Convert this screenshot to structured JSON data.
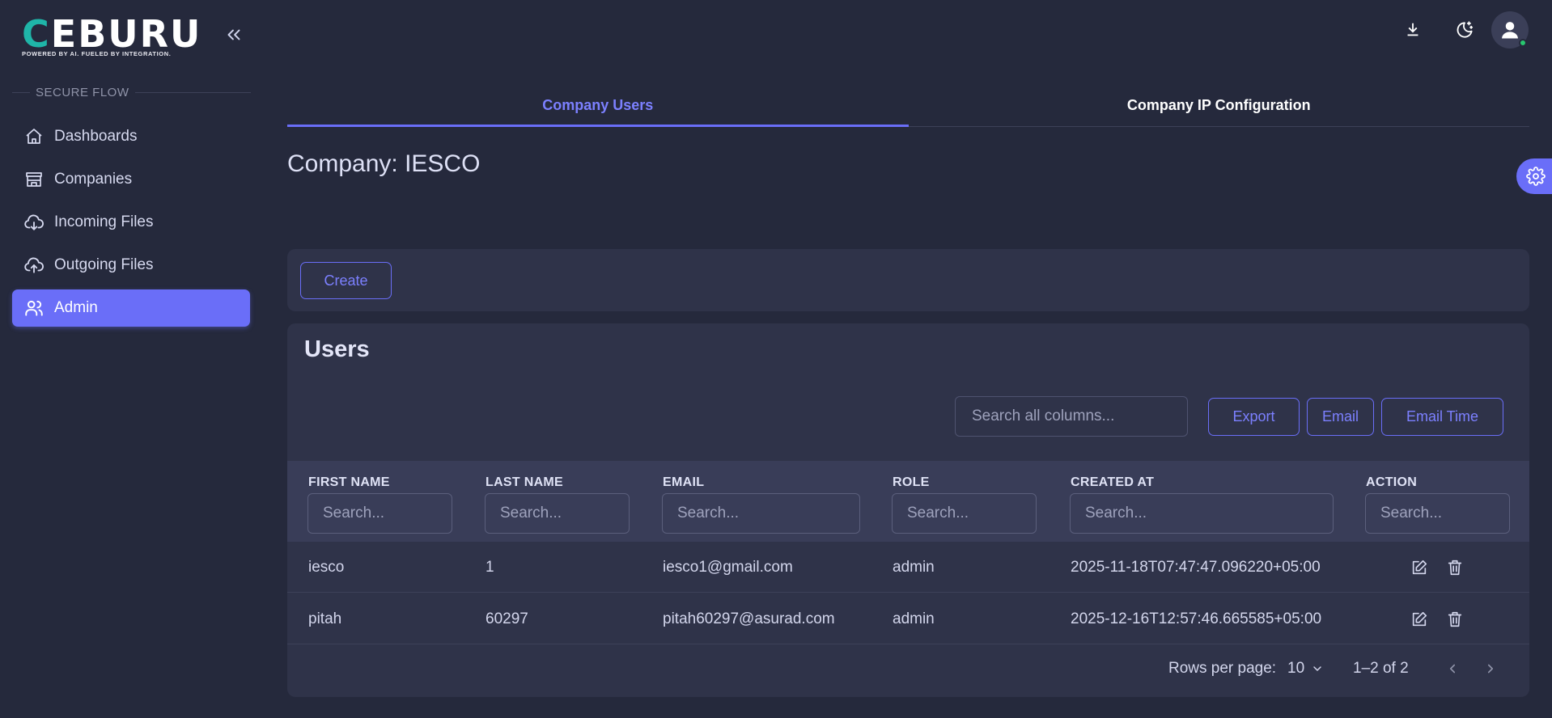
{
  "brand": {
    "logo_text": "CEBURU",
    "tagline": "POWERED BY AI. FUELED BY INTEGRATION."
  },
  "sidebar": {
    "section_label": "SECURE FLOW",
    "items": [
      {
        "label": "Dashboards",
        "icon": "home-icon"
      },
      {
        "label": "Companies",
        "icon": "store-icon"
      },
      {
        "label": "Incoming Files",
        "icon": "cloud-download-icon"
      },
      {
        "label": "Outgoing Files",
        "icon": "cloud-upload-icon"
      },
      {
        "label": "Admin",
        "icon": "users-icon",
        "active": true
      }
    ]
  },
  "tabs": [
    {
      "label": "Company Users",
      "active": true
    },
    {
      "label": "Company IP Configuration",
      "active": false
    }
  ],
  "page_title": "Company: IESCO",
  "create_button": "Create",
  "users": {
    "title": "Users",
    "search_placeholder": "Search all columns...",
    "buttons": {
      "export": "Export",
      "email": "Email",
      "email_time": "Email Time"
    },
    "columns": [
      "FIRST NAME",
      "LAST NAME",
      "EMAIL",
      "ROLE",
      "CREATED AT",
      "ACTION"
    ],
    "column_search_placeholder": "Search...",
    "rows": [
      {
        "first_name": "iesco",
        "last_name": "1",
        "email": "iesco1@gmail.com",
        "role": "admin",
        "created_at": "2025-11-18T07:47:47.096220+05:00"
      },
      {
        "first_name": "pitah",
        "last_name": "60297",
        "email": "pitah60297@asurad.com",
        "role": "admin",
        "created_at": "2025-12-16T12:57:46.665585+05:00"
      }
    ],
    "pagination": {
      "rows_per_page_label": "Rows per page:",
      "rows_per_page": "10",
      "range": "1–2 of 2"
    }
  },
  "colors": {
    "accent": "#6a6ef8",
    "background": "#25293c",
    "card": "#2f3349",
    "status_online": "#28c76f"
  }
}
